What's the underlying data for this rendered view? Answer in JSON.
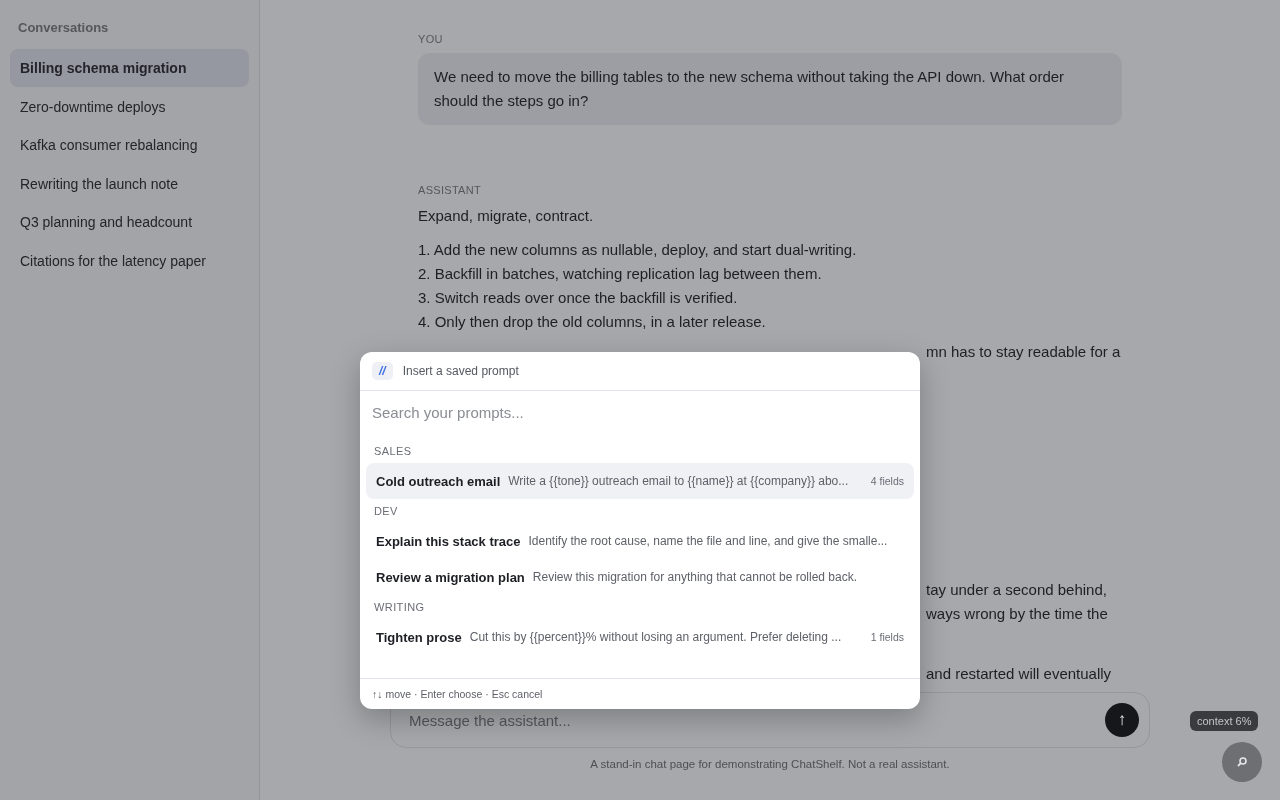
{
  "sidebar": {
    "title": "Conversations",
    "items": [
      {
        "label": "Billing schema migration",
        "selected": true
      },
      {
        "label": "Zero-downtime deploys",
        "selected": false
      },
      {
        "label": "Kafka consumer rebalancing",
        "selected": false
      },
      {
        "label": "Rewriting the launch note",
        "selected": false
      },
      {
        "label": "Q3 planning and headcount",
        "selected": false
      },
      {
        "label": "Citations for the latency paper",
        "selected": false
      }
    ]
  },
  "chat": {
    "user": {
      "label": "YOU",
      "text": "We need to move the billing tables to the new schema without taking the API down. What order should the steps go in?"
    },
    "assistant": {
      "label": "ASSISTANT",
      "intro": "Expand, migrate, contract.",
      "steps": [
        "1. Add the new columns as nullable, deploy, and start dual-writing.",
        "2. Backfill in batches, watching replication lag between them.",
        "3. Switch reads over once the backfill is verified.",
        "4. Only then drop the old columns, in a later release."
      ],
      "fragments": [
        "mn has to stay readable for a",
        "tay under a second behind,",
        "ways wrong by the time the",
        "and restarted will eventually"
      ]
    }
  },
  "prompt_picker": {
    "badge": "//",
    "title": "Insert a saved prompt",
    "search": {
      "placeholder": "Search your prompts..."
    },
    "groups": [
      {
        "label": "SALES",
        "items": [
          {
            "title": "Cold outreach email",
            "description": "Write a {{tone}} outreach email to {{name}} at {{company}} abo...",
            "fields": "4 fields",
            "selected": true
          }
        ]
      },
      {
        "label": "DEV",
        "items": [
          {
            "title": "Explain this stack trace",
            "description": "Identify the root cause, name the file and line, and give the smalle...",
            "selected": false
          },
          {
            "title": "Review a migration plan",
            "description": "Review this migration for anything that cannot be rolled back.",
            "selected": false
          }
        ]
      },
      {
        "label": "WRITING",
        "items": [
          {
            "title": "Tighten prose",
            "description": "Cut this by {{percent}}% without losing an argument. Prefer deleting ...",
            "fields": "1 fields",
            "selected": false
          }
        ]
      }
    ],
    "footer": "↑↓ move · Enter choose · Esc cancel"
  },
  "composer": {
    "placeholder": "Message the assistant...",
    "send": "↑"
  },
  "footer_note": "A stand-in chat page for demonstrating ChatShelf. Not a real assistant.",
  "context_badge": "context 6%"
}
